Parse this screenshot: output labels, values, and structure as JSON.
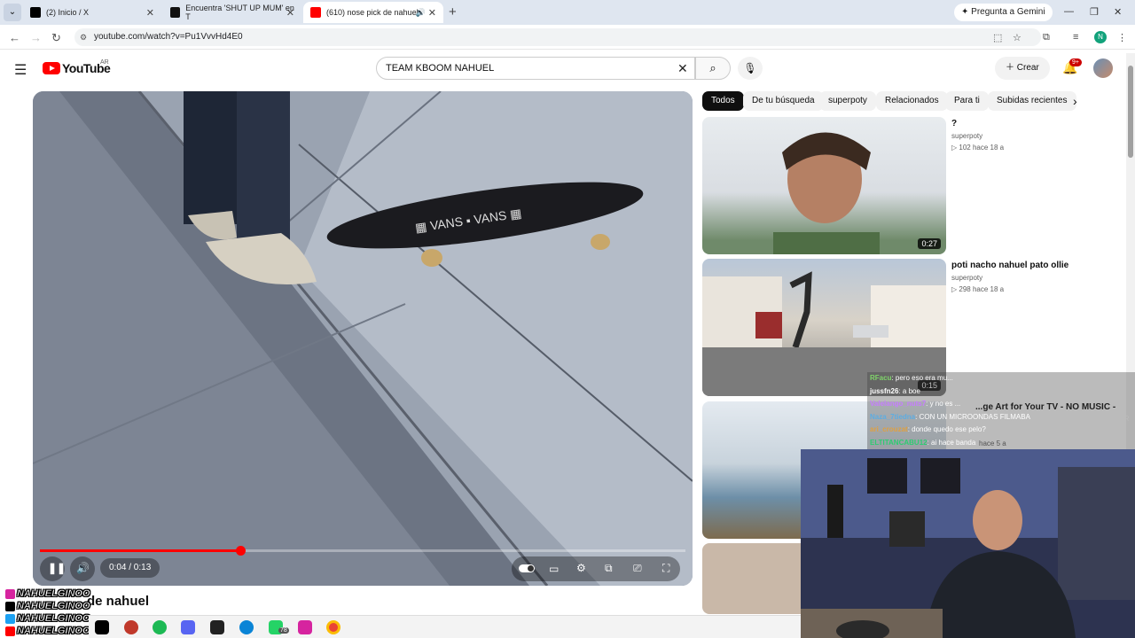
{
  "browser": {
    "tabs": [
      {
        "title": "(2) Inicio / X",
        "icon": "x-logo-icon",
        "color": "#000000"
      },
      {
        "title": "Encuentra 'SHUT UP MUM' en T",
        "icon": "tiktok-icon",
        "color": "#000000"
      },
      {
        "title": "(610) nose pick de nahuel",
        "icon": "youtube-icon",
        "color": "#ff0000"
      }
    ],
    "new_tab": "+",
    "gemini_button": "Pregunta a Gemini",
    "url": "youtube.com/watch?v=Pu1VvvHd4E0",
    "profile_initial": "N"
  },
  "youtube": {
    "logo": "YouTube",
    "region": "AR",
    "search_query": "TEAM KBOOM NAHUEL",
    "create_label": "Crear",
    "notifications": "9+",
    "accent": "#ff0000"
  },
  "player": {
    "time": "0:04 / 0:13",
    "progress": 0.31
  },
  "video_title": "de nahuel",
  "chips": [
    "Todos",
    "De tu búsqueda",
    "superpoty",
    "Relacionados",
    "Para ti",
    "Subidas recientes"
  ],
  "recommendations": [
    {
      "title": "?",
      "channel": "superpoty",
      "meta": "▷ 102  hace 18 a",
      "duration": "0:27"
    },
    {
      "title": "poti nacho nahuel pato ollie",
      "channel": "superpoty",
      "meta": "▷ 298  hace 18 a",
      "duration": "0:15"
    },
    {
      "title": "...ge Art for Your TV - NO MUSIC -",
      "channel": "...CON UN MICROONDAS FILMABA ...EENSAVER",
      "meta": "hace 5 a",
      "duration": ""
    }
  ],
  "chat": [
    {
      "user": "RFacu",
      "text": ": pero eso era mu...",
      "color": "#7fd36a"
    },
    {
      "user": "jussfn26",
      "text": ": a boe",
      "color": "#ffffff"
    },
    {
      "user": "Valelango_nuts7",
      "text": ": y no es ...",
      "color": "#c77dff"
    },
    {
      "user": "Naza_7tiedna",
      "text": ": CON UN MICROONDAS FILMABA",
      "color": "#5dade2"
    },
    {
      "user": "ari_crouzat",
      "text": ": donde quedo ese pelo?",
      "color": "#e0a040"
    },
    {
      "user": "ELTITANCABU12",
      "text": ": ai hace banda",
      "color": "#2ecc71"
    }
  ],
  "social": [
    "NAHUELGINOO",
    "NAHUELGINOO",
    "NAHUELGINOO",
    "NAHUELGINOOK"
  ],
  "taskbar_badge": "78"
}
